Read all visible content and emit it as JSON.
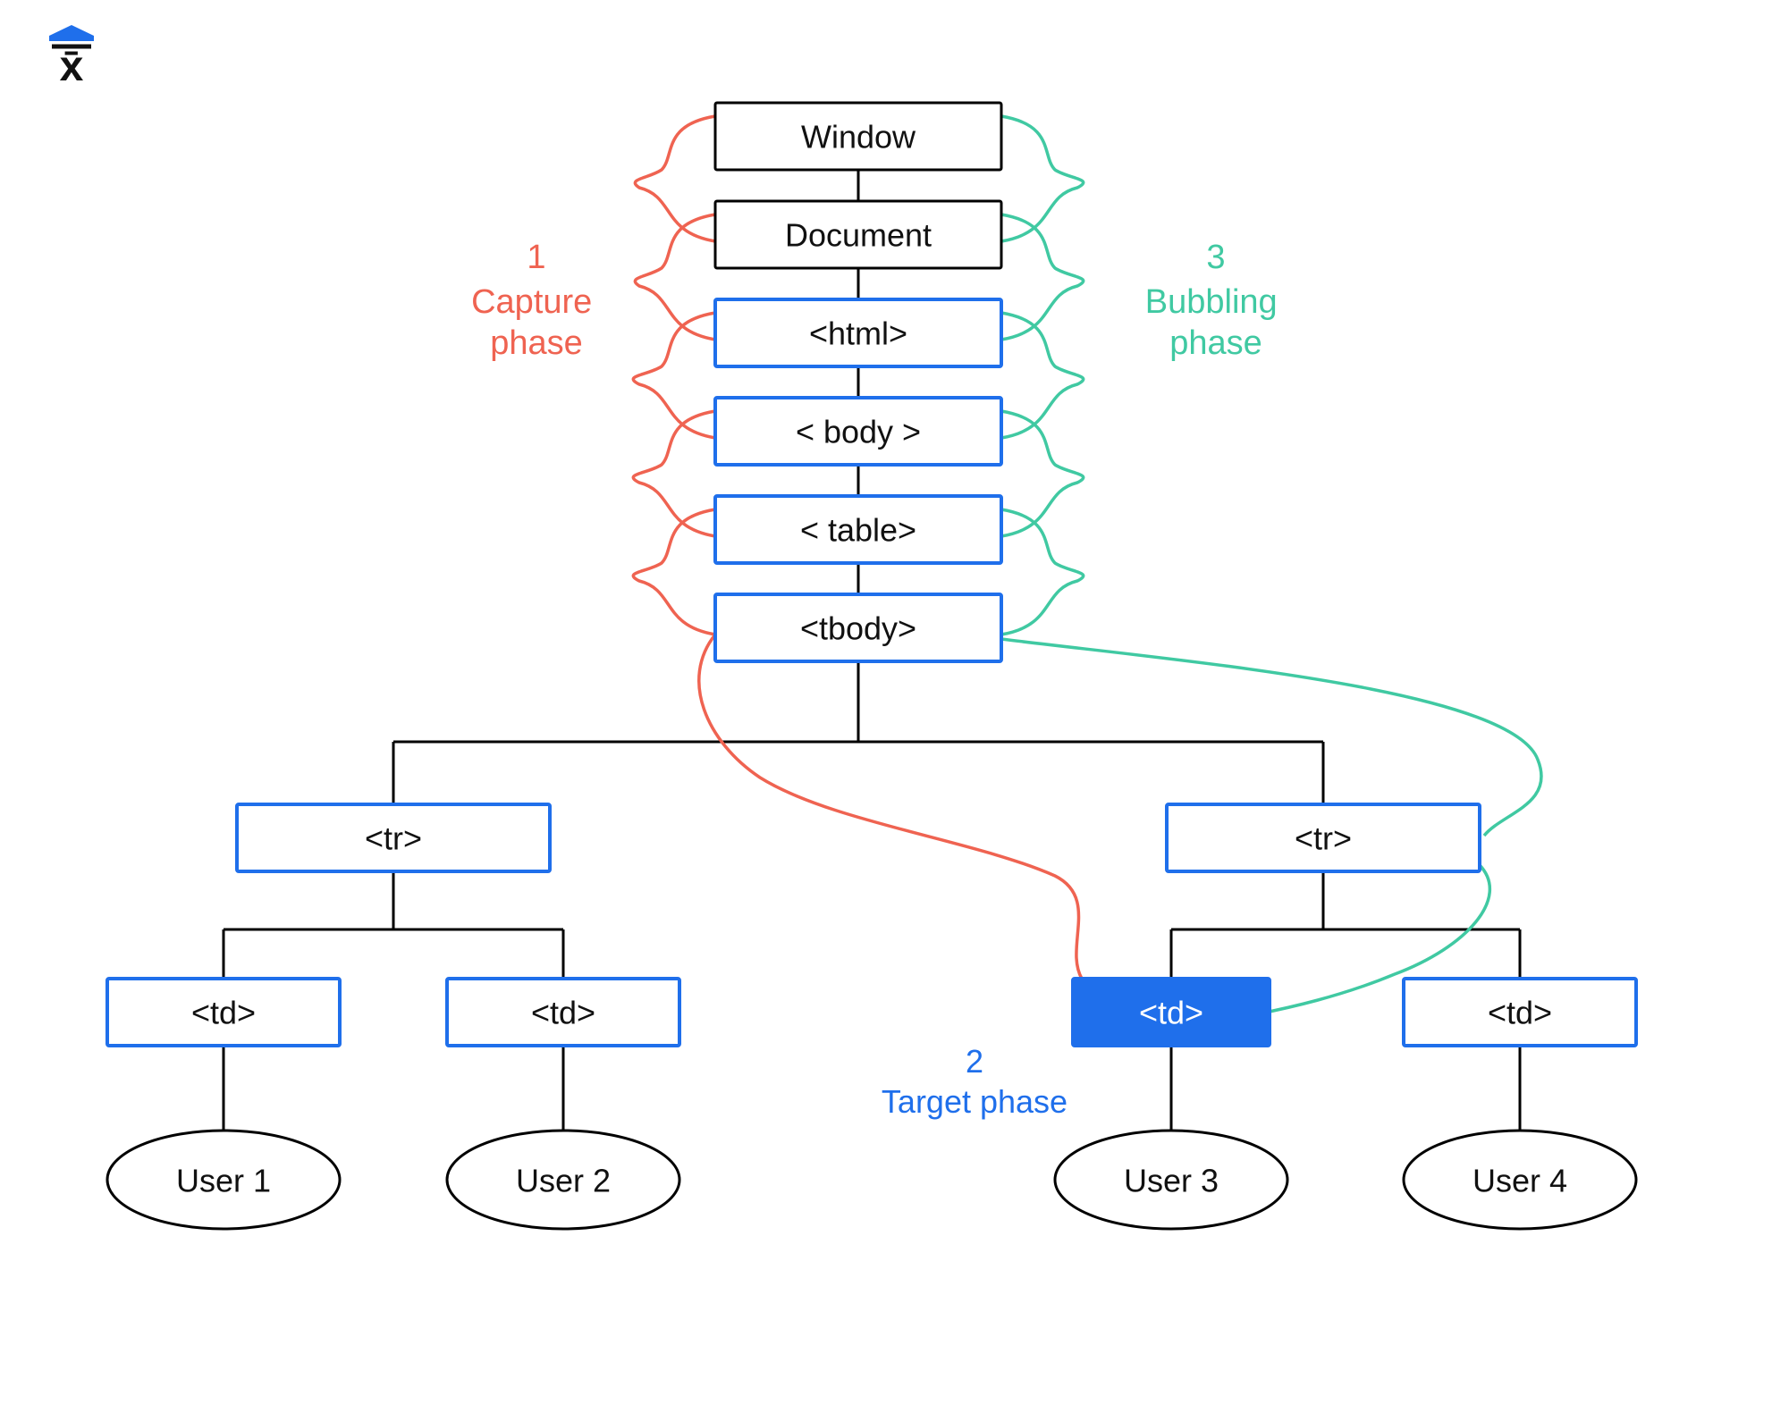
{
  "logo": {
    "letter": "x̄"
  },
  "phases": {
    "capture": {
      "num": "1",
      "label": "Capture\nphase"
    },
    "target": {
      "num": "2",
      "label": "Target phase"
    },
    "bubbling": {
      "num": "3",
      "label": "Bubbling\nphase"
    }
  },
  "nodes": {
    "window": {
      "label": "Window"
    },
    "document": {
      "label": "Document"
    },
    "html": {
      "label": "<html>"
    },
    "body": {
      "label": "< body >"
    },
    "table": {
      "label": "< table>"
    },
    "tbody": {
      "label": "<tbody>"
    },
    "tr1": {
      "label": "<tr>"
    },
    "tr2": {
      "label": "<tr>"
    },
    "td1": {
      "label": "<td>"
    },
    "td2": {
      "label": "<td>"
    },
    "td3": {
      "label": "<td>"
    },
    "td4": {
      "label": "<td>"
    },
    "user1": {
      "label": "User 1"
    },
    "user2": {
      "label": "User 2"
    },
    "user3": {
      "label": "User 3"
    },
    "user4": {
      "label": "User 4"
    }
  },
  "colors": {
    "blue": "#1f6feb",
    "red": "#ef6351",
    "green": "#40c9a2",
    "black": "#000000"
  },
  "diagram": {
    "description": "DOM event propagation tree showing capture, target and bubbling phases",
    "target_node": "td3",
    "capture_path": [
      "window",
      "document",
      "html",
      "body",
      "table",
      "tbody",
      "tr2",
      "td3"
    ],
    "bubbling_path": [
      "td3",
      "tr2",
      "tbody",
      "table",
      "body",
      "html",
      "document",
      "window"
    ]
  }
}
